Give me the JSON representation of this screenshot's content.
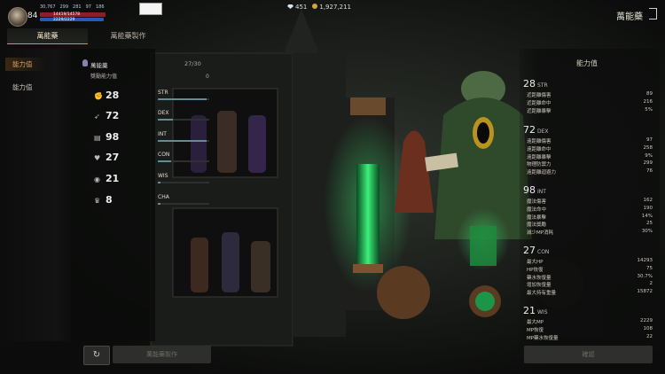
{
  "hud": {
    "level": "84",
    "combat_power": "30,767",
    "stat_a": "299",
    "stat_b": "281",
    "stat_c": "97",
    "stat_d": "186",
    "hp_text": "14419/14578",
    "mp_text": "2229/2229"
  },
  "currency": {
    "gems": "451",
    "gold": "1,927,211"
  },
  "header": {
    "title": "萬能藥"
  },
  "tabs": [
    {
      "label": "萬能藥"
    },
    {
      "label": "萬能藥製作"
    }
  ],
  "sidebar": {
    "items": [
      {
        "label": "能力值"
      },
      {
        "label": "能力值"
      }
    ]
  },
  "potion": {
    "name": "萬能藥",
    "sub": "獎勵能力值",
    "count": "27/30",
    "zero": "0"
  },
  "stats": [
    {
      "icon": "fist-icon",
      "value": "28"
    },
    {
      "icon": "feather-icon",
      "value": "72"
    },
    {
      "icon": "book-icon",
      "value": "98"
    },
    {
      "icon": "heart-icon",
      "value": "27"
    },
    {
      "icon": "eye-icon",
      "value": "21"
    },
    {
      "icon": "crown-icon",
      "value": "8"
    }
  ],
  "bars": [
    {
      "label": "STR",
      "fill": 0.95
    },
    {
      "label": "DEX",
      "fill": 0.3
    },
    {
      "label": "INT",
      "fill": 0.95
    },
    {
      "label": "CON",
      "fill": 0.25
    },
    {
      "label": "WIS",
      "fill": 0.05
    },
    {
      "label": "CHA",
      "fill": 0.05
    }
  ],
  "ability_panel": {
    "title": "能力值",
    "groups": [
      {
        "value": "28",
        "key": "STR",
        "rows": [
          {
            "label": "近距離傷害",
            "value": "89"
          },
          {
            "label": "近距離命中",
            "value": "216"
          },
          {
            "label": "近距離暴擊",
            "value": "5%"
          }
        ]
      },
      {
        "value": "72",
        "key": "DEX",
        "rows": [
          {
            "label": "遠距離傷害",
            "value": "97"
          },
          {
            "label": "遠距離命中",
            "value": "258"
          },
          {
            "label": "遠距離暴擊",
            "value": "9%"
          },
          {
            "label": "物理防禦力",
            "value": "299"
          },
          {
            "label": "遠距離迴避力",
            "value": "76"
          }
        ]
      },
      {
        "value": "98",
        "key": "INT",
        "rows": [
          {
            "label": "魔法傷害",
            "value": "162"
          },
          {
            "label": "魔法命中",
            "value": "190"
          },
          {
            "label": "魔法暴擊",
            "value": "14%"
          },
          {
            "label": "魔法獎勵",
            "value": "25"
          },
          {
            "label": "減少MP消耗",
            "value": "30%"
          }
        ]
      },
      {
        "value": "27",
        "key": "CON",
        "rows": [
          {
            "label": "最大HP",
            "value": "14293"
          },
          {
            "label": "HP恢復",
            "value": "75"
          },
          {
            "label": "藥水恢復量",
            "value": "30.7%"
          },
          {
            "label": "增加恢復量",
            "value": "2"
          },
          {
            "label": "最大持有重量",
            "value": "15872"
          }
        ]
      },
      {
        "value": "21",
        "key": "WIS",
        "rows": [
          {
            "label": "最大MP",
            "value": "2229"
          },
          {
            "label": "MP恢復",
            "value": "108"
          },
          {
            "label": "MP藥水恢復量",
            "value": "22"
          }
        ]
      }
    ]
  },
  "buttons": {
    "refresh": "↻",
    "create": "萬能藥製作",
    "confirm": "確認"
  }
}
